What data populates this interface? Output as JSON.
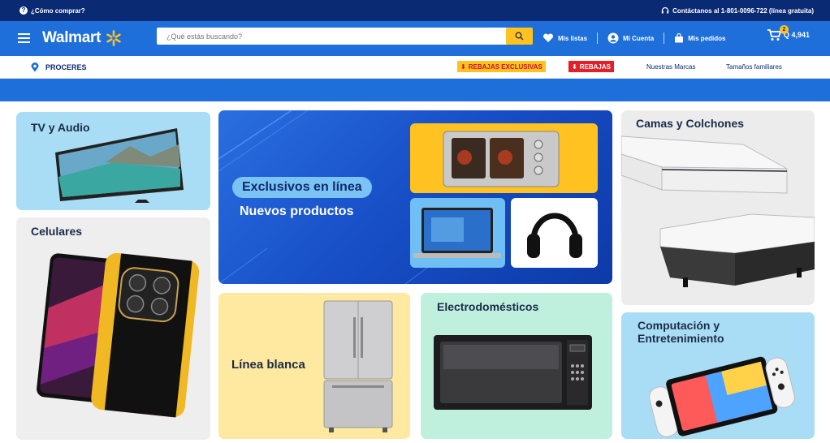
{
  "topbar": {
    "help_text": "¿Cómo comprar?",
    "contact_text": "Contáctanos al 1-801-0096-722 (línea gratuita)"
  },
  "header": {
    "logo_text": "Walmart",
    "search_placeholder": "¿Qué estás buscando?",
    "my_lists": "Mis listas",
    "my_account": "Mi Cuenta",
    "my_orders": "Mis pedidos",
    "cart_count": "2",
    "cart_total": "Q 4,941"
  },
  "subnav": {
    "location": "PROCERES",
    "exclusive_deals": "REBAJAS EXCLUSIVAS",
    "deals": "REBAJAS",
    "brands": "Nuestras Marcas",
    "family_sizes": "Tamaños familiares"
  },
  "cards": {
    "tv": "TV y Audio",
    "phones": "Celulares",
    "hero_pill": "Exclusivos en línea",
    "hero_sub": "Nuevos productos",
    "beds": "Camas y Colchones",
    "white_line": "Línea blanca",
    "appliances": "Electrodomésticos",
    "computing": "Computación y Entretenimiento"
  },
  "colors": {
    "navy": "#0a2a73",
    "brand_blue": "#1e6fd9",
    "spark_yellow": "#ffc220",
    "deal_red": "#e41f26"
  }
}
